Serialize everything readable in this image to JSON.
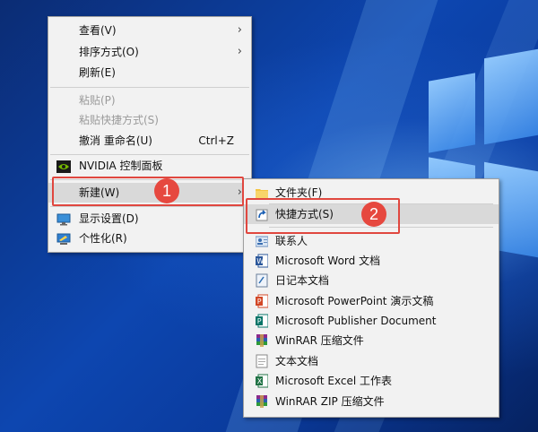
{
  "context_menu": {
    "items": [
      {
        "label": "查看(V)",
        "has_submenu": true
      },
      {
        "label": "排序方式(O)",
        "has_submenu": true
      },
      {
        "label": "刷新(E)"
      },
      {
        "label": "粘贴(P)",
        "disabled": true
      },
      {
        "label": "粘贴快捷方式(S)",
        "disabled": true
      },
      {
        "label": "撤消 重命名(U)",
        "shortcut": "Ctrl+Z"
      },
      {
        "label": "NVIDIA 控制面板",
        "icon": "nvidia-icon"
      },
      {
        "label": "新建(W)",
        "has_submenu": true,
        "highlighted": true
      },
      {
        "label": "显示设置(D)",
        "icon": "display-icon"
      },
      {
        "label": "个性化(R)",
        "icon": "personalize-icon"
      }
    ]
  },
  "new_submenu": {
    "items": [
      {
        "label": "文件夹(F)",
        "icon": "folder-icon"
      },
      {
        "label": "快捷方式(S)",
        "icon": "shortcut-icon",
        "highlighted": true
      },
      {
        "label": "联系人",
        "icon": "contact-icon"
      },
      {
        "label": "Microsoft Word 文档",
        "icon": "word-icon"
      },
      {
        "label": "日记本文档",
        "icon": "journal-icon"
      },
      {
        "label": "Microsoft PowerPoint 演示文稿",
        "icon": "powerpoint-icon"
      },
      {
        "label": "Microsoft Publisher Document",
        "icon": "publisher-icon"
      },
      {
        "label": "WinRAR 压缩文件",
        "icon": "winrar-icon"
      },
      {
        "label": "文本文档",
        "icon": "text-document-icon"
      },
      {
        "label": "Microsoft Excel 工作表",
        "icon": "excel-icon"
      },
      {
        "label": "WinRAR ZIP 压缩文件",
        "icon": "winrar-zip-icon"
      }
    ]
  },
  "annotations": {
    "step1": "1",
    "step2": "2",
    "color": "#e6483f"
  },
  "colors": {
    "menu_bg": "#f2f2f2",
    "highlight_bg": "#d9d9d9",
    "desktop_blue": "#0d46b0"
  }
}
